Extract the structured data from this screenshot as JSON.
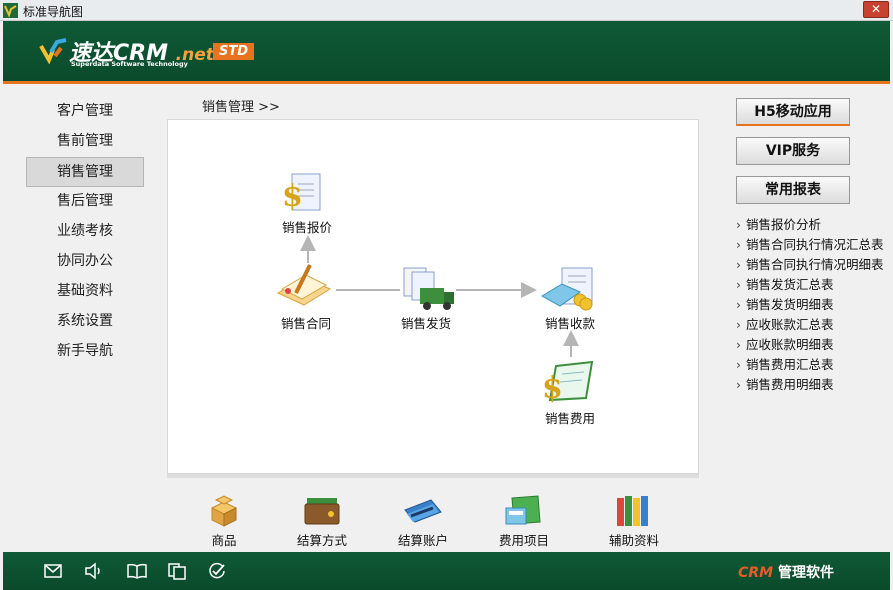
{
  "window": {
    "title": "标准导航图"
  },
  "header": {
    "brand": "速达CRM",
    "brand_suffix": ".net",
    "tagline": "Superdata Software Technology",
    "edition": "STD"
  },
  "sidebar": {
    "items": [
      {
        "label": "客户管理"
      },
      {
        "label": "售前管理"
      },
      {
        "label": "销售管理",
        "active": true
      },
      {
        "label": "售后管理"
      },
      {
        "label": "业绩考核"
      },
      {
        "label": "协同办公"
      },
      {
        "label": "基础资料"
      },
      {
        "label": "系统设置"
      },
      {
        "label": "新手导航"
      }
    ]
  },
  "breadcrumb": {
    "text": "销售管理  >>"
  },
  "flow": {
    "quote": "销售报价",
    "contract": "销售合同",
    "delivery": "销售发货",
    "receipt": "销售收款",
    "expense": "销售费用"
  },
  "tools": [
    {
      "label": "商品"
    },
    {
      "label": "结算方式"
    },
    {
      "label": "结算账户"
    },
    {
      "label": "费用项目"
    },
    {
      "label": "辅助资料"
    }
  ],
  "right": {
    "buttons": [
      {
        "label": "H5移动应用"
      },
      {
        "label": "VIP服务"
      },
      {
        "label": "常用报表"
      }
    ],
    "reports": [
      "销售报价分析",
      "销售合同执行情况汇总表",
      "销售合同执行情况明细表",
      "销售发货汇总表",
      "销售发货明细表",
      "应收账款汇总表",
      "应收账款明细表",
      "销售费用汇总表",
      "销售费用明细表"
    ]
  },
  "footer": {
    "crm": "CRM",
    "label": "管理软件"
  },
  "colors": {
    "brand_green": "#0a4a2b",
    "accent_orange": "#e8731e"
  }
}
